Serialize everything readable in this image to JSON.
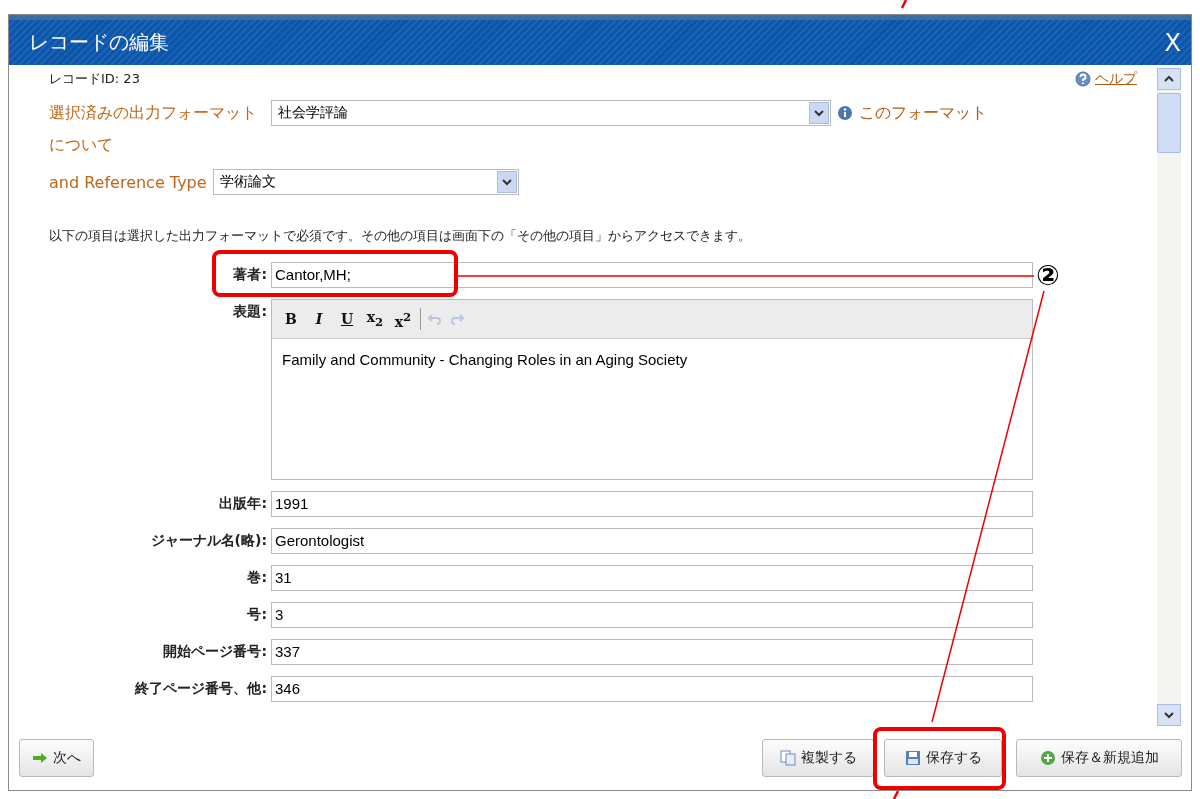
{
  "window": {
    "title": "レコードの編集",
    "close": "X"
  },
  "record_id": "レコードID: 23",
  "help": "ヘルプ",
  "output_format": {
    "label": "選択済みの出力フォーマット",
    "value": "社会学評論",
    "about_link": "このフォーマット",
    "about_link_cont": "について"
  },
  "reference_type": {
    "label": "and Reference Type",
    "value": "学術論文"
  },
  "notice": "以下の項目は選択した出力フォーマットで必須です。その他の項目は画面下の「その他の項目」からアクセスできます。",
  "fields": [
    {
      "kind": "text",
      "label": "著者:",
      "value": "Cantor,MH;"
    },
    {
      "kind": "richtext",
      "label": "表題:",
      "value": "Family and Community - Changing Roles in an Aging Society",
      "toolbar": [
        "B",
        "I",
        "U",
        "x$_{2}$",
        "x$^{2}$"
      ],
      "history": [
        {
          "kind": "undo",
          "disabled": true
        },
        {
          "kind": "redo",
          "disabled": true
        }
      ]
    },
    {
      "kind": "text",
      "label": "出版年:",
      "value": "1991"
    },
    {
      "kind": "text",
      "label": "ジャーナル名(略):",
      "value": "Gerontologist"
    },
    {
      "kind": "text",
      "label": "巻:",
      "value": "31"
    },
    {
      "kind": "text",
      "label": "号:",
      "value": "3"
    },
    {
      "kind": "text",
      "label": "開始ページ番号:",
      "value": "337"
    },
    {
      "kind": "text",
      "label": "終了ページ番号、他:",
      "value": "346"
    }
  ],
  "footer": {
    "next": {
      "kind": "next",
      "label": "次へ"
    },
    "buttons": [
      {
        "kind": "copy",
        "label": "複製する"
      },
      {
        "kind": "save",
        "label": "保存する"
      },
      {
        "kind": "add",
        "label": "保存＆新規追加"
      }
    ]
  },
  "annotation": {
    "label": "②"
  }
}
